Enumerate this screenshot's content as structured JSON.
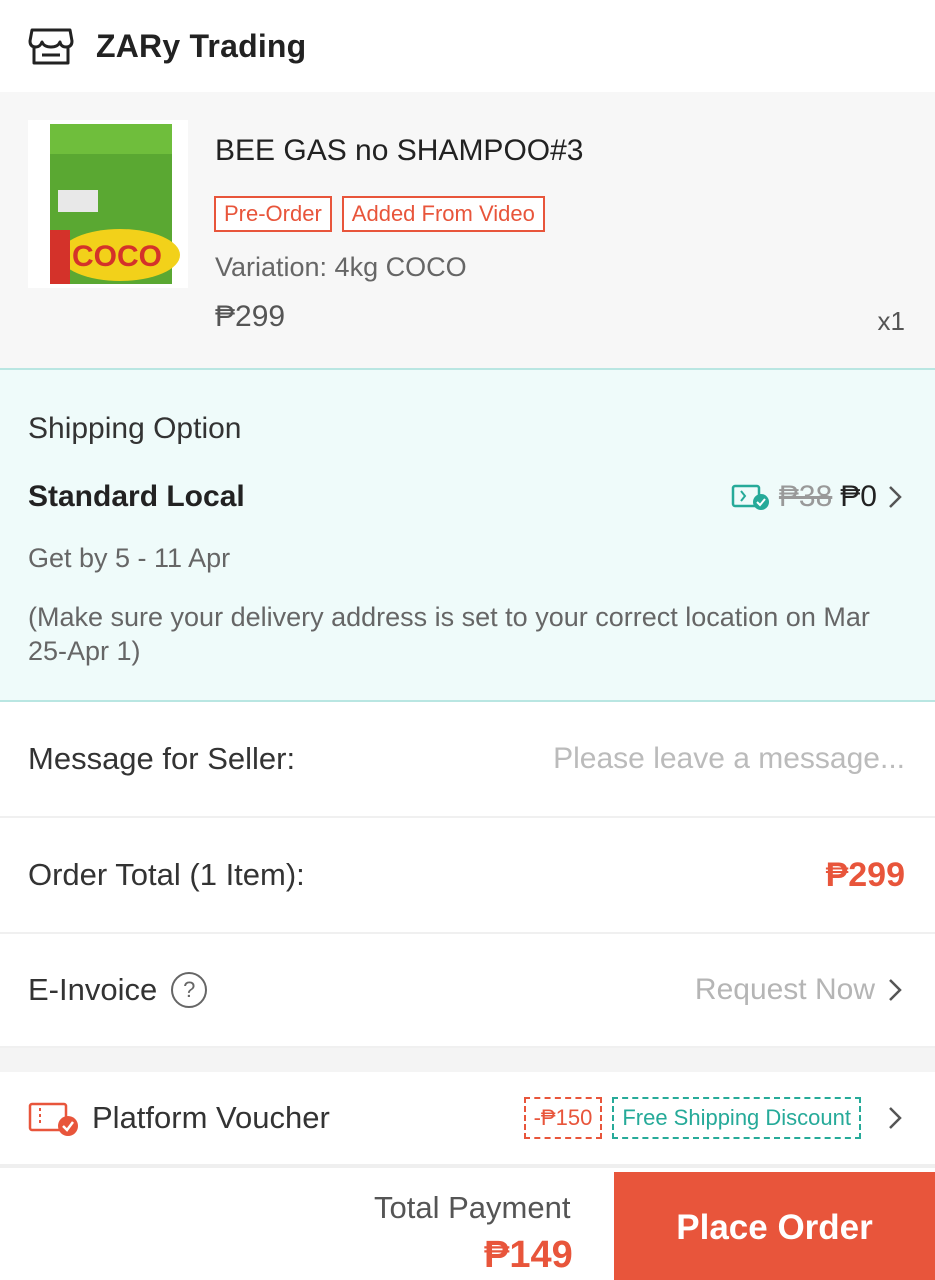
{
  "shop": {
    "name": "ZARy Trading",
    "icon": "store-icon"
  },
  "product": {
    "name": "BEE GAS no SHAMPOO#3",
    "tags": [
      "Pre-Order",
      "Added From Video"
    ],
    "variation": "Variation: 4kg COCO",
    "price": "₱299",
    "quantity": "x1",
    "image_label": "COCO"
  },
  "shipping": {
    "title": "Shipping Option",
    "method": "Standard Local",
    "fee_original": "₱38",
    "fee_current": "₱0",
    "eta": "Get by 5 - 11 Apr",
    "note": "(Make sure your delivery address is set to your correct location on Mar 25-Apr 1)",
    "icon": "free-shipping-voucher-icon",
    "accent": "#26aa99"
  },
  "message": {
    "label": "Message for Seller:",
    "placeholder": "Please leave a message..."
  },
  "order_total": {
    "label": "Order Total (1 Item):",
    "amount": "₱299"
  },
  "invoice": {
    "label": "E-Invoice",
    "help": "?",
    "action": "Request Now"
  },
  "voucher": {
    "label": "Platform Voucher",
    "discount_chip": "-₱150",
    "shipping_chip": "Free Shipping Discount"
  },
  "footer": {
    "total_label": "Total Payment",
    "total_amount": "₱149",
    "place_order": "Place Order"
  },
  "colors": {
    "brand": "#e8553b",
    "teal": "#26aa99"
  }
}
